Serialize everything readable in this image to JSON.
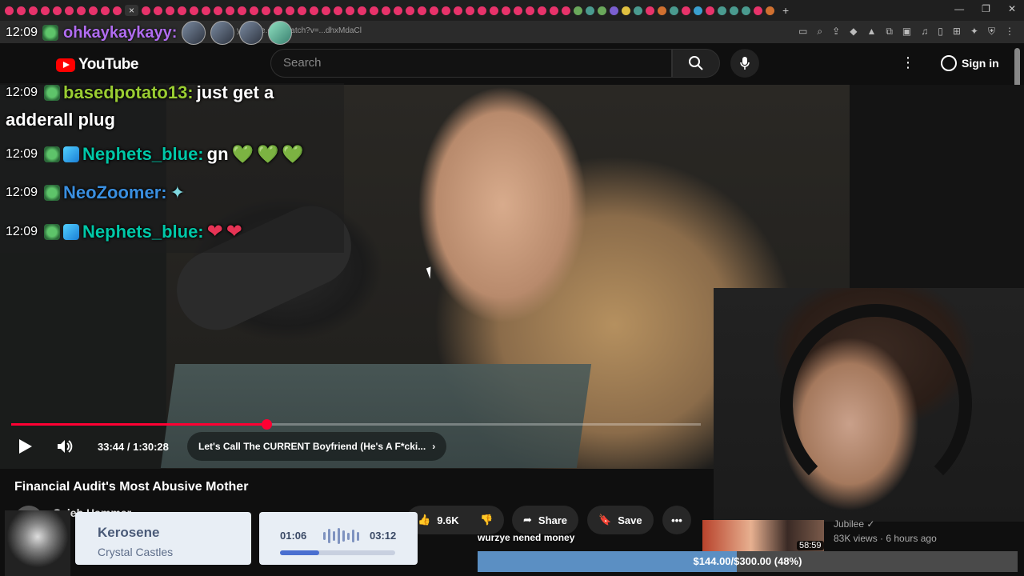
{
  "browser": {
    "url": "youtube.com/watch?v=...dhxMdaCl",
    "tab_dot_colors": [
      "#e8336b",
      "#e8336b",
      "#e8336b",
      "#e8336b",
      "#e8336b",
      "#e8336b",
      "#e8336b",
      "#e8336b",
      "#e8336b",
      "#e8336b",
      "#e8336b",
      "#e8336b",
      "#e8336b",
      "#e8336b",
      "#e8336b",
      "#e8336b",
      "#e8336b",
      "#e8336b",
      "#e8336b",
      "#e8336b",
      "#e8336b",
      "#e8336b",
      "#e8336b",
      "#e8336b",
      "#e8336b",
      "#e8336b",
      "#e8336b",
      "#e8336b",
      "#e8336b",
      "#e8336b",
      "#e8336b",
      "#e8336b",
      "#e8336b",
      "#e8336b",
      "#e8336b",
      "#e8336b",
      "#e8336b",
      "#e8336b",
      "#e8336b",
      "#e8336b",
      "#e8336b",
      "#e8336b",
      "#e8336b",
      "#e8336b",
      "#e8336b",
      "#e8336b",
      "#6aa85b",
      "#4a9a8f",
      "#6aa85b",
      "#7a5fd0",
      "#e0c040",
      "#4a9a8f",
      "#e8336b",
      "#d07030",
      "#4a9a8f",
      "#e8336b",
      "#3aa0d0",
      "#e8336b",
      "#4a9a8f",
      "#4a9a8f",
      "#4a9a8f",
      "#e8336b",
      "#d07030"
    ],
    "close_tab_glyph": "×",
    "new_tab_glyph": "+",
    "window_controls": [
      "—",
      "❐",
      "✕"
    ],
    "toolbar_icons": [
      "▭",
      "⌕",
      "⇪",
      "◆",
      "▲",
      "⧉",
      "▣",
      "♫",
      "▯",
      "⊞",
      "✦",
      "⛨",
      "⋮"
    ]
  },
  "chat": {
    "top": {
      "time": "12:09",
      "user": "ohkaykaykayy:"
    },
    "lines": [
      {
        "time": "12:09",
        "user": "basedpotato13:",
        "color": "#9acd32",
        "msg": "just get a",
        "msg2": "adderall plug",
        "badges": [
          "frog"
        ]
      },
      {
        "time": "12:09",
        "user": "Nephets_blue:",
        "color": "#00c8a8",
        "msg": "gn",
        "emotes": [
          "💚",
          "💚",
          "💚"
        ],
        "badges": [
          "frog",
          "cube"
        ]
      },
      {
        "time": "12:09",
        "user": "NeoZoomer:",
        "color": "#3a8fe0",
        "msg": "",
        "emotes": [
          "✦"
        ],
        "badges": [
          "frog"
        ]
      },
      {
        "time": "12:09",
        "user": "Nephets_blue:",
        "color": "#00c8a8",
        "msg": "",
        "emotes": [
          "❤",
          "❤"
        ],
        "badges": [
          "frog",
          "cube"
        ]
      }
    ]
  },
  "youtube": {
    "logo_text": "YouTube",
    "search_placeholder": "Search",
    "search_icon": "search-icon",
    "mic_icon": "mic-icon",
    "more_icon": "⋮",
    "signin_label": "Sign in"
  },
  "player": {
    "progress_fraction": 0.37,
    "current_time": "33:44",
    "duration": "1:30:28",
    "time_display": "33:44 / 1:30:28",
    "chapter": "Let's Call The CURRENT Boyfriend (He's A F*cki...",
    "chapter_arrow": "›",
    "volume_icon": "🔊"
  },
  "video": {
    "title": "Financial Audit's Most Abusive Mother",
    "channel": "Caleb Hammer"
  },
  "actions": {
    "likes": "9.6K",
    "like_icon": "👍",
    "dislike_icon": "👎",
    "share": "Share",
    "share_icon": "➦",
    "save": "Save",
    "save_icon": "🔖",
    "more": "•••"
  },
  "recommendation": {
    "duration": "58:59",
    "channel": "Jubilee ✓",
    "meta": "83K views · 6 hours ago"
  },
  "music": {
    "title": "Kerosene",
    "artist": "Crystal Castles",
    "elapsed": "01:06",
    "total": "03:12",
    "progress_fraction": 0.34
  },
  "goal": {
    "label": "wurzye nened money",
    "text": "$144.00/$300.00 (48%)",
    "fraction": 0.48
  }
}
